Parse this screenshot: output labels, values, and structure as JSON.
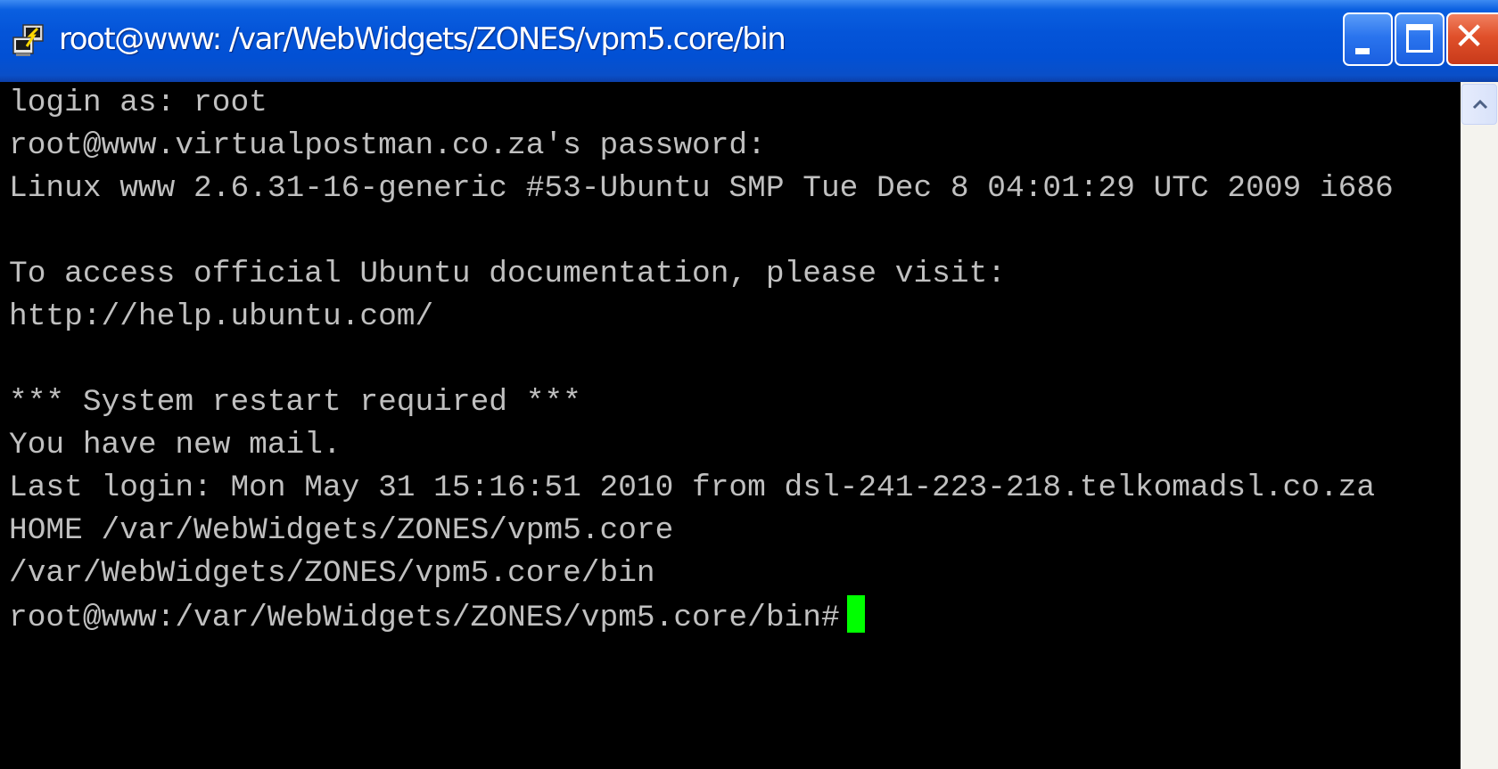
{
  "window": {
    "title": "root@www: /var/WebWidgets/ZONES/vpm5.core/bin",
    "app_icon": "putty-icon",
    "controls": {
      "minimize": "minimize-icon",
      "maximize": "maximize-icon",
      "close": "close-icon"
    }
  },
  "terminal": {
    "background": "#000000",
    "foreground": "#c0c0c0",
    "cursor_color": "#00ff00",
    "lines": [
      "login as: root",
      "root@www.virtualpostman.co.za's password:",
      "Linux www 2.6.31-16-generic #53-Ubuntu SMP Tue Dec 8 04:01:29 UTC 2009 i686",
      "",
      "To access official Ubuntu documentation, please visit:",
      "http://help.ubuntu.com/",
      "",
      "*** System restart required ***",
      "You have new mail.",
      "Last login: Mon May 31 15:16:51 2010 from dsl-241-223-218.telkomadsl.co.za",
      "HOME /var/WebWidgets/ZONES/vpm5.core",
      "/var/WebWidgets/ZONES/vpm5.core/bin",
      "root@www:/var/WebWidgets/ZONES/vpm5.core/bin#"
    ]
  },
  "scrollbar": {
    "up_arrow": "chevron-up-icon"
  }
}
